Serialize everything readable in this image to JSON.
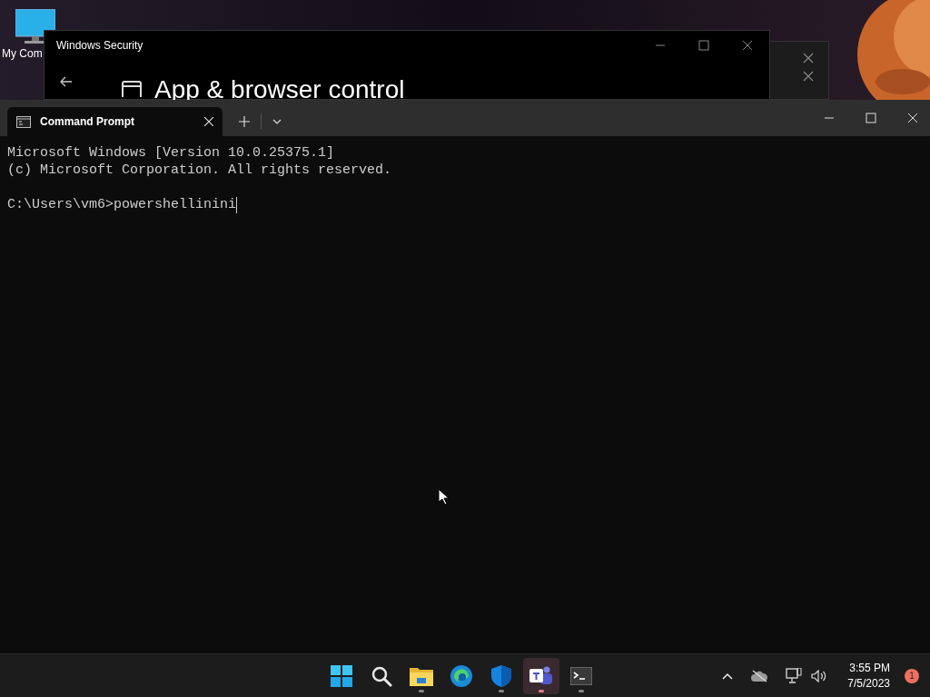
{
  "desktop_icons": [
    {
      "label": "My Com"
    }
  ],
  "security_window": {
    "title": "Windows Security",
    "heading": "App & browser control"
  },
  "terminal": {
    "tabs": [
      {
        "label": "Command Prompt",
        "selected": true
      }
    ],
    "lines": [
      "Microsoft Windows [Version 10.0.25375.1]",
      "(c) Microsoft Corporation. All rights reserved."
    ],
    "prompt": "C:\\Users\\vm6>",
    "input": "powershellinini"
  },
  "taskbar": {
    "apps": [
      {
        "kind": "start",
        "running": false,
        "active": false
      },
      {
        "kind": "search",
        "running": false,
        "active": false
      },
      {
        "kind": "folder",
        "running": true,
        "active": false
      },
      {
        "kind": "browser",
        "running": false,
        "active": false
      },
      {
        "kind": "shield",
        "running": true,
        "active": false
      },
      {
        "kind": "teams",
        "running": true,
        "active": true
      },
      {
        "kind": "terminal",
        "running": true,
        "active": false
      }
    ],
    "time": "3:55 PM",
    "date": "7/5/2023",
    "notifications": "1"
  }
}
